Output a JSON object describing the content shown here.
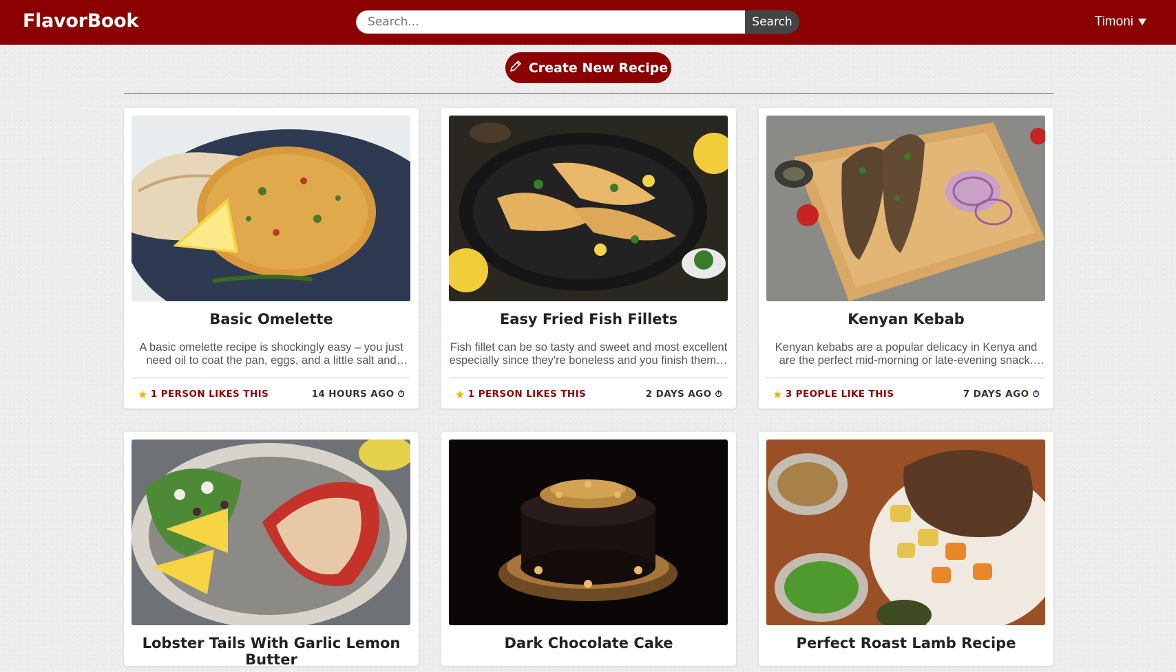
{
  "app": {
    "brand": "FlavorBook"
  },
  "search": {
    "placeholder": "Search...",
    "button_label": "Search"
  },
  "user": {
    "name": "Timoni"
  },
  "create": {
    "label": "Create New Recipe",
    "icon": "pencil-icon"
  },
  "recipes": [
    {
      "title": "Basic Omelette",
      "description": "A basic omelette recipe is shockingly easy – you just need oil to coat the pan, eggs, and a little salt and pepper.",
      "likes": "1 PERSON LIKES THIS",
      "time": "14 HOURS AGO"
    },
    {
      "title": "Easy Fried Fish Fillets",
      "description": "Fish fillet can be so tasty and sweet and most excellent especially since they're boneless and you finish them in minutes.",
      "likes": "1 PERSON LIKES THIS",
      "time": "2 DAYS AGO"
    },
    {
      "title": "Kenyan Kebab",
      "description": "Kenyan kebabs are a popular delicacy in Kenya and are the perfect mid-morning or late-evening snack. They are delicious.",
      "likes": "3 PEOPLE LIKE THIS",
      "time": "7 DAYS AGO"
    },
    {
      "title": "Lobster Tails With Garlic Lemon Butter"
    },
    {
      "title": "Dark Chocolate Cake"
    },
    {
      "title": "Perfect Roast Lamb Recipe"
    }
  ],
  "colors": {
    "brand": "#8b0000",
    "search_button": "#444444",
    "star": "#f0b400",
    "clock": "#1c2a4a"
  }
}
